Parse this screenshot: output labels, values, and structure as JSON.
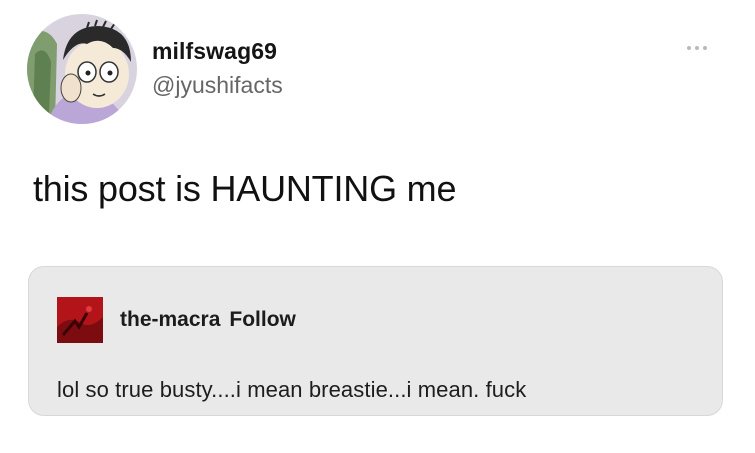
{
  "post": {
    "display_name": "milfswag69",
    "handle": "@jyushifacts",
    "text": "this post is HAUNTING me",
    "more_icon": "more-horizontal-icon"
  },
  "quote": {
    "username": "the-macra",
    "follow_label": "Follow",
    "text": "lol so true busty....i mean breastie...i mean. fuck"
  },
  "colors": {
    "quote_background": "#e9e9e9",
    "handle": "#666666",
    "quote_avatar": "#b3141a"
  }
}
